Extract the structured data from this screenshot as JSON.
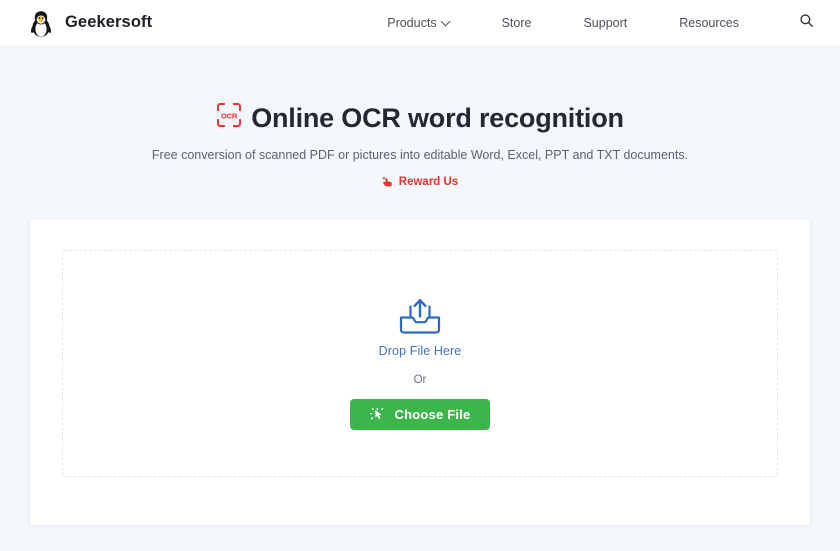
{
  "header": {
    "brand_name": "Geekersoft",
    "logo_icon": "penguin-logo",
    "nav": [
      {
        "label": "Products",
        "has_dropdown": true,
        "icon": "chevron-down-icon"
      },
      {
        "label": "Store",
        "has_dropdown": false
      },
      {
        "label": "Support",
        "has_dropdown": false
      },
      {
        "label": "Resources",
        "has_dropdown": false
      }
    ],
    "search_icon": "search-icon"
  },
  "hero": {
    "badge_icon": "ocr-scan-icon",
    "badge_text": "OCR",
    "title": "Online OCR word recognition",
    "subtitle": "Free conversion of scanned PDF or pictures into editable Word, Excel, PPT and TXT documents.",
    "reward_label": "Reward Us",
    "reward_icon": "reward-hand-icon"
  },
  "upload": {
    "drop_icon": "upload-tray-icon",
    "drop_label": "Drop File Here",
    "or_label": "Or",
    "button_label": "Choose File",
    "button_icon": "cursor-click-icon"
  },
  "colors": {
    "page_background": "#f4f7fb",
    "header_background": "#ffffff",
    "card_background": "#ffffff",
    "accent_green": "#3cb54a",
    "accent_blue": "#4272c4",
    "accent_red": "#e8302f",
    "title_text": "#242830",
    "body_text": "#5d636d",
    "dashed_border": "#e2e5ea"
  }
}
